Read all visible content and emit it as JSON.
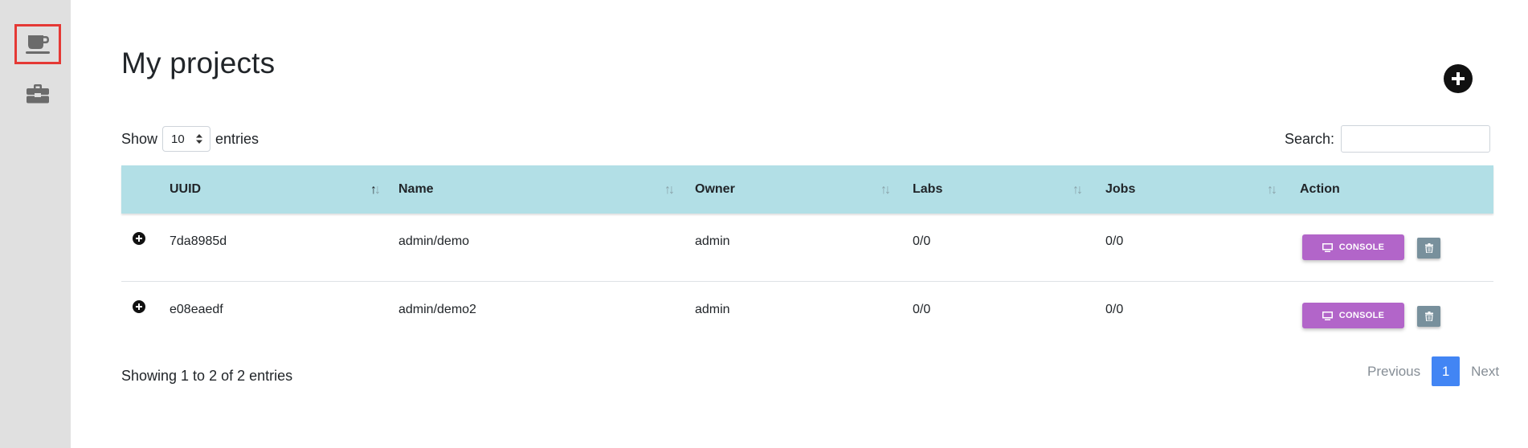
{
  "sidebar": {
    "items": [
      {
        "icon": "coffee-cup-icon",
        "active": true
      },
      {
        "icon": "toolbox-icon",
        "active": false
      }
    ]
  },
  "page": {
    "title": "My projects",
    "add_icon": "plus-circle-icon"
  },
  "length": {
    "show_label": "Show",
    "value": "10",
    "entries_label": "entries"
  },
  "search": {
    "label": "Search:",
    "value": "",
    "placeholder": ""
  },
  "table": {
    "columns": [
      "UUID",
      "Name",
      "Owner",
      "Labs",
      "Jobs",
      "Action"
    ],
    "sorted_column": "UUID",
    "sort_direction": "ascending",
    "rows": [
      {
        "uuid": "7da8985d",
        "name": "admin/demo",
        "owner": "admin",
        "labs": "0/0",
        "jobs": "0/0",
        "console_label": "CONSOLE"
      },
      {
        "uuid": "e08eaedf",
        "name": "admin/demo2",
        "owner": "admin",
        "labs": "0/0",
        "jobs": "0/0",
        "console_label": "CONSOLE"
      }
    ]
  },
  "footer": {
    "info": "Showing 1 to 2 of 2 entries",
    "previous": "Previous",
    "current_page": "1",
    "next": "Next"
  },
  "colors": {
    "header_bg": "#b2dfe6",
    "console_button": "#b265c9",
    "delete_button": "#78909c",
    "active_page": "#4285f4",
    "sidebar_bg": "#e0e0e0",
    "active_highlight": "#e53935"
  }
}
